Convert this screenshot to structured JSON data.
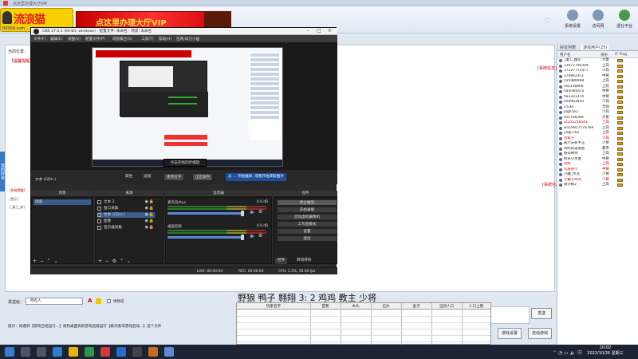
{
  "host": {
    "window_title": "点这里办理大厅VIP",
    "vip_banner": "点这里办理大厅VIP",
    "logo_text": "流浪猫",
    "logo_sub": "00000.com",
    "top_buttons": [
      "系统设置",
      "访问网",
      "透社平台"
    ],
    "room_label": "当前位置：",
    "announcement": "【温馨提醒】",
    "system_msg": "[系统信息]",
    "left_messages": [
      "[系统提醒]",
      "[提示]",
      "[_康工_新]"
    ],
    "left_strip": "我的好友",
    "user_tabs": [
      "好友列表",
      "游戏用户(25)"
    ],
    "user_headers": [
      "用户名",
      "身份",
      "IT Flag"
    ],
    "users": [
      {
        "name": "_康工_醒茫",
        "role": "大佬",
        "red": false
      },
      {
        "name": "13672790349",
        "role": "上岗",
        "red": false
      },
      {
        "name": "17127772477",
        "role": "少岗",
        "red": false
      },
      {
        "name": "276842311",
        "role": "中将",
        "red": false
      },
      {
        "name": "435988998",
        "role": "上岗",
        "red": false
      },
      {
        "name": "ceo136800",
        "role": "上岗",
        "red": false
      },
      {
        "name": "hanlli8anco",
        "role": "中将",
        "red": false
      },
      {
        "name": "ha3331314",
        "role": "中将",
        "red": false
      },
      {
        "name": "he0963820",
        "role": "少岗",
        "red": false
      },
      {
        "name": "lcl1ks",
        "role": "元帅",
        "red": false
      },
      {
        "name": "pigh1e2",
        "role": "少岗",
        "red": false
      },
      {
        "name": "s05706288",
        "role": "大佬",
        "red": false
      },
      {
        "name": "sz255258541",
        "role": "上岗",
        "red": true
      },
      {
        "name": "w119917576769",
        "role": "上岗",
        "red": false
      },
      {
        "name": "yngu782",
        "role": "上岗",
        "red": false
      },
      {
        "name": "百家子",
        "role": "少岗",
        "red": true
      },
      {
        "name": "羁六天新手王",
        "role": "少将",
        "red": false
      },
      {
        "name": "鸣鸣的美观屋",
        "role": "都市",
        "red": false
      },
      {
        "name": "偷得稀你",
        "role": "上岗",
        "red": false
      },
      {
        "name": "修长小水匿",
        "role": "中将",
        "red": false
      },
      {
        "name": "鸿辉",
        "role": "上岗",
        "red": true
      },
      {
        "name": "鸟族余小",
        "role": "中将",
        "red": true
      },
      {
        "name": "小魔_传话",
        "role": "少将",
        "red": false
      },
      {
        "name": "小撤子鸡鸡",
        "role": "少将",
        "red": true
      },
      {
        "name": "硕沙桃2",
        "role": "上岗",
        "red": false
      }
    ],
    "send_label": "发送给：",
    "send_target": "所有人",
    "peek_label": "悄悄说",
    "tip_line": "提示：如遇到【游戏已经运行...】请到桌面找到游戏后再运行【解决者非游戏启动...】这个文件",
    "send_button": "发送",
    "bottom_buttons": [
      "游戏设置",
      "自动游戏"
    ]
  },
  "obs": {
    "title": "OBS 27.0.1 (64-bit, windows) - 配置文件: 未命名 - 场景: 未命名",
    "menu": [
      "文件(F)",
      "编辑(E)",
      "视图(V)",
      "配置文件(P)",
      "场景集合(S)",
      "工具(T)",
      "帮助(H)",
      "在两-四方小画"
    ],
    "source_label": "文本 (GDI+)",
    "tooltip": "点击开始同步播放",
    "toolbar": [
      "属性",
      "滤镜",
      "更改文字",
      "出区颜色",
      "从 ... 开始截屏, 或者开始获取图片"
    ],
    "docks": [
      "场景",
      "来源",
      "混音器",
      "场景转场",
      "控件"
    ],
    "scene": "场景",
    "sources": [
      {
        "name": "文本 2",
        "sel": false
      },
      {
        "name": "窗口采集",
        "sel": false
      },
      {
        "name": "文本 (GDI+)",
        "sel": true
      },
      {
        "name": "图像",
        "sel": false
      },
      {
        "name": "显示器采集",
        "sel": false
      }
    ],
    "mixer": [
      {
        "name": "麦克风/Aux",
        "db": "0.0 dB"
      },
      {
        "name": "桌面音频",
        "db": "0.0 dB"
      }
    ],
    "controls": [
      "停止推流",
      "开始录制",
      "启动虚拟摄像机",
      "工作室模式",
      "设置",
      "退出"
    ],
    "bottom_tabs": [
      "控件",
      "转场特效"
    ],
    "status": [
      "LIVE: 00:00:00",
      "REC: 00:00:00",
      "CPU: 3.3%, 30.00 fps"
    ]
  },
  "overlay": {
    "headline": "野狼 鸭子 翱翔 3: 2 鸡鸡 教主 少将",
    "table_headers": [
      "玩家名字",
      "首勢",
      "木头",
      "石头",
      "金子",
      "当前人口",
      "人口上限"
    ]
  },
  "taskbar": {
    "time": "10:02",
    "date": "2022/10/26 星期三"
  },
  "colors": {
    "accent": "#3a78c4",
    "vip_red": "#c80000",
    "obs_bg": "#2b2b2b",
    "alert_red": "#cc0000"
  }
}
